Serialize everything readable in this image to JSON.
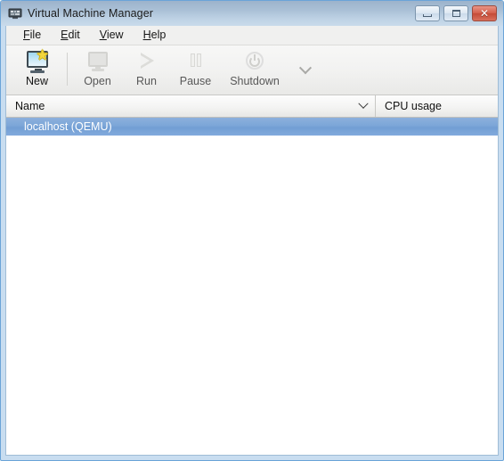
{
  "window": {
    "title": "Virtual Machine Manager",
    "icon": "vm-manager-icon",
    "controls": {
      "minimize_label": "–",
      "maximize_label": "□",
      "close_label": "✕",
      "minimize_name": "minimize-button",
      "maximize_name": "maximize-button",
      "close_name": "close-button"
    },
    "accent_titlebar_top": "#9cb3cb",
    "accent_titlebar_bottom": "#c9dbeb",
    "frame_border": "#6aa4d8"
  },
  "menubar": {
    "items": [
      {
        "label": "File",
        "accel": "F",
        "rest": "ile"
      },
      {
        "label": "Edit",
        "accel": "E",
        "rest": "dit"
      },
      {
        "label": "View",
        "accel": "V",
        "rest": "iew"
      },
      {
        "label": "Help",
        "accel": "H",
        "rest": "elp"
      }
    ]
  },
  "toolbar": {
    "items": [
      {
        "label": "New",
        "icon": "new-vm-monitor-star-icon",
        "enabled": true
      },
      {
        "label": "Open",
        "icon": "open-monitor-icon",
        "enabled": false
      },
      {
        "label": "Run",
        "icon": "run-play-icon",
        "enabled": false
      },
      {
        "label": "Pause",
        "icon": "pause-bars-icon",
        "enabled": false
      },
      {
        "label": "Shutdown",
        "icon": "shutdown-power-icon",
        "enabled": false
      }
    ],
    "overflow_icon": "chevron-down-icon"
  },
  "list": {
    "columns": [
      {
        "label": "Name",
        "sort_indicator": "chevron-down-icon"
      },
      {
        "label": "CPU usage",
        "sort_indicator": ""
      }
    ],
    "rows": [
      {
        "name": "localhost (QEMU)",
        "cpu_usage": "",
        "selected": true
      }
    ],
    "selection_color": "#7ca6d8"
  }
}
